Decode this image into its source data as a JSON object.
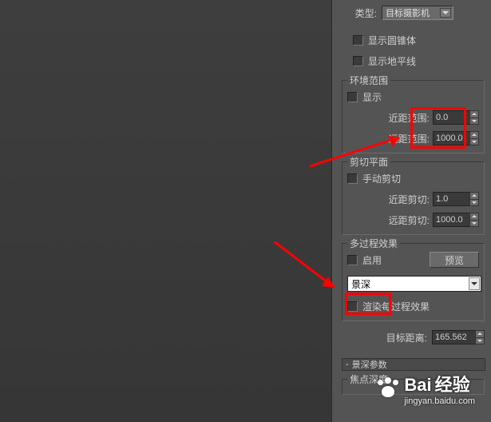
{
  "type_row": {
    "label": "类型:",
    "value": "目标摄影机"
  },
  "show_cone": "显示圆锥体",
  "show_horizon": "显示地平线",
  "env_range": {
    "title": "环境范围",
    "show": "显示",
    "near_label": "近距范围:",
    "near_value": "0.0",
    "far_label": "远距范围:",
    "far_value": "1000.0"
  },
  "clip_plane": {
    "title": "剪切平面",
    "manual": "手动剪切",
    "near_label": "近距剪切:",
    "near_value": "1.0",
    "far_label": "远距剪切:",
    "far_value": "1000.0"
  },
  "multipass": {
    "title": "多过程效果",
    "enable": "启用",
    "preview": "预览",
    "effect": "景深",
    "render_per": "渲染每过程效果"
  },
  "target_dist": {
    "label": "目标距离:",
    "value": "165.562"
  },
  "rollout": "景深参数",
  "focal_depth": "焦点深度",
  "watermark": {
    "brand_a": "Bai",
    "brand_b": "经验",
    "url": "jingyan.baidu.com"
  }
}
